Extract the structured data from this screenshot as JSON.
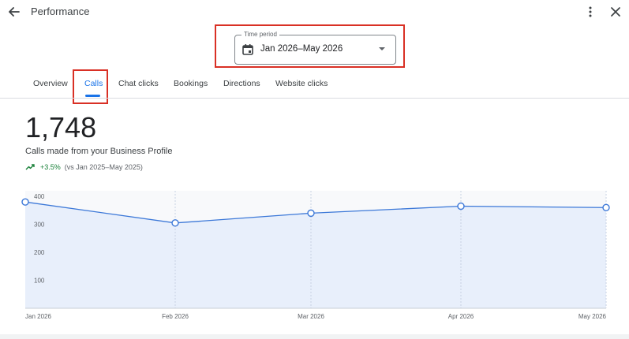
{
  "header": {
    "title": "Performance",
    "back_icon": "arrow-back-icon",
    "more_icon": "more-vert-icon",
    "close_icon": "close-icon"
  },
  "time_period": {
    "label": "Time period",
    "value": "Jan 2026–May 2026",
    "icon": "calendar-icon"
  },
  "tabs": [
    {
      "label": "Overview",
      "active": false
    },
    {
      "label": "Calls",
      "active": true
    },
    {
      "label": "Chat clicks",
      "active": false
    },
    {
      "label": "Bookings",
      "active": false
    },
    {
      "label": "Directions",
      "active": false
    },
    {
      "label": "Website clicks",
      "active": false
    }
  ],
  "metric": {
    "value": "1,748",
    "description": "Calls made from your Business Profile",
    "change": "+3.5%",
    "comparison": "(vs Jan 2025–May 2025)"
  },
  "colors": {
    "accent": "#1a73e8",
    "highlight": "#d93025",
    "positive": "#188038",
    "area_fill": "#e8effb",
    "line": "#3c78d8"
  },
  "chart_data": {
    "type": "area",
    "categories": [
      "Jan 2026",
      "Feb 2026",
      "Mar 2026",
      "Apr 2026",
      "May 2026"
    ],
    "values": [
      380,
      305,
      340,
      365,
      360
    ],
    "y_ticks": [
      100,
      200,
      300,
      400
    ],
    "ylim": [
      0,
      420
    ]
  }
}
